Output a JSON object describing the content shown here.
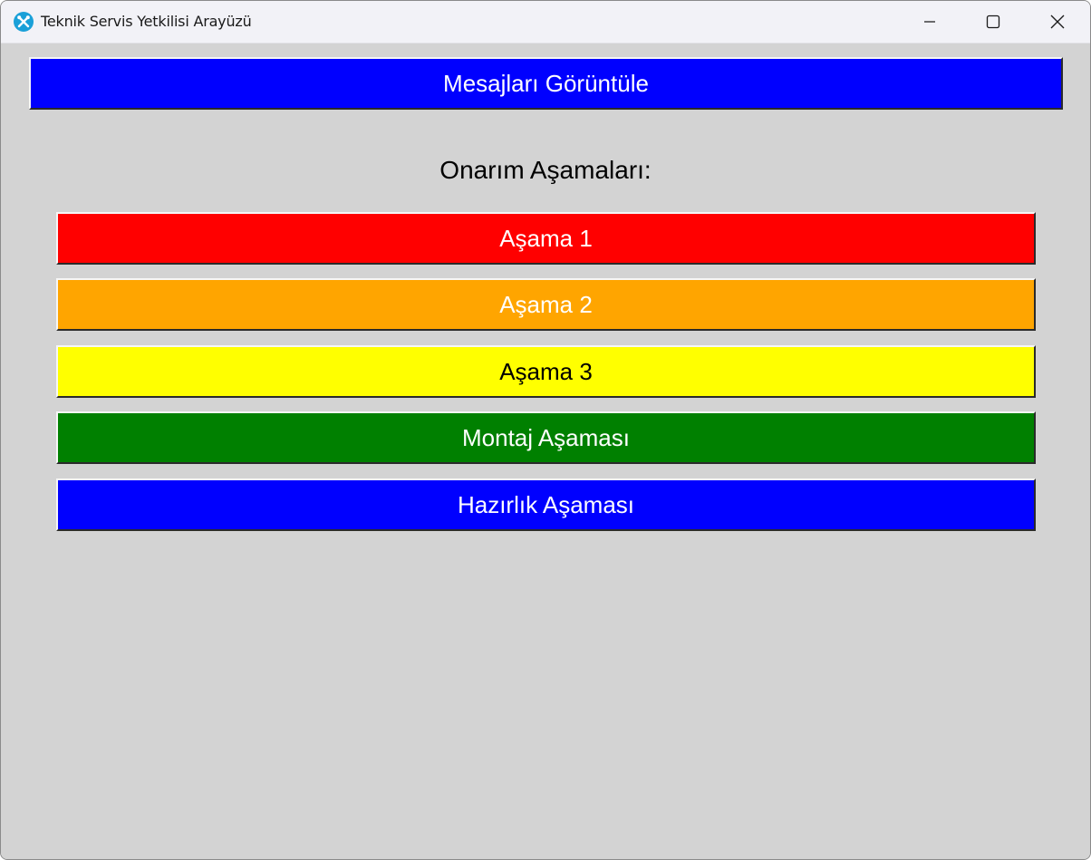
{
  "window": {
    "title": "Teknik Servis Yetkilisi Arayüzü",
    "icon": "tools-icon",
    "controls": [
      "minimize-icon",
      "maximize-icon",
      "close-icon"
    ]
  },
  "main": {
    "messages_button": {
      "label": "Mesajları Görüntüle",
      "bg": "#0000ff",
      "fg": "#ffffff"
    },
    "stages_heading": "Onarım Aşamaları:",
    "stages": [
      {
        "label": "Aşama 1",
        "bg": "#ff0000",
        "fg": "#ffffff"
      },
      {
        "label": "Aşama 2",
        "bg": "#ffa500",
        "fg": "#ffffff"
      },
      {
        "label": "Aşama 3",
        "bg": "#ffff00",
        "fg": "#000000"
      },
      {
        "label": "Montaj Aşaması",
        "bg": "#008000",
        "fg": "#ffffff"
      },
      {
        "label": "Hazırlık Aşaması",
        "bg": "#0000ff",
        "fg": "#ffffff"
      }
    ]
  }
}
